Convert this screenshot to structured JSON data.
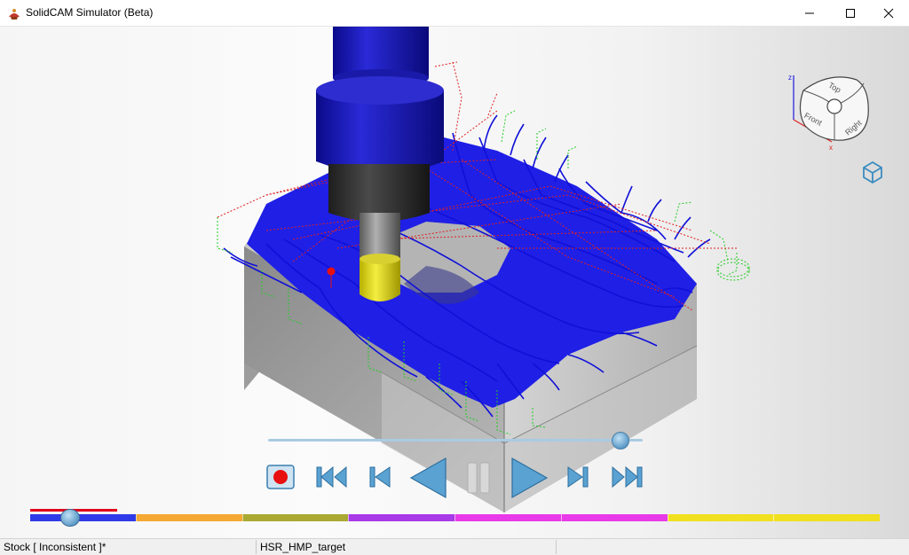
{
  "window": {
    "title": "SolidCAM Simulator (Beta)",
    "controls": {
      "minimize_icon": "minimize-icon",
      "maximize_icon": "maximize-icon",
      "close_icon": "close-icon"
    }
  },
  "viewcube": {
    "faces": {
      "top": "Top",
      "front": "Front",
      "right": "Right"
    },
    "axes": {
      "z": "z",
      "x": "x"
    }
  },
  "playback": {
    "speed_level": 0.94,
    "buttons": [
      {
        "name": "record-button",
        "icon": "record-icon"
      },
      {
        "name": "skip-to-start-button",
        "icon": "skip-to-start-icon"
      },
      {
        "name": "step-back-button",
        "icon": "step-back-icon"
      },
      {
        "name": "play-reverse-button",
        "icon": "play-reverse-icon"
      },
      {
        "name": "pause-button",
        "icon": "pause-icon"
      },
      {
        "name": "play-button",
        "icon": "play-icon"
      },
      {
        "name": "step-forward-button",
        "icon": "step-forward-icon"
      },
      {
        "name": "skip-to-end-button",
        "icon": "skip-to-end-icon"
      }
    ]
  },
  "timeline": {
    "position": 0.047,
    "segment_colors": [
      "#2f3be8",
      "#f5a833",
      "#a9a933",
      "#a83ae8",
      "#e83ae8",
      "#e83ae8",
      "#f0e020",
      "#f0e020"
    ],
    "completed_color": "#e0001b"
  },
  "status": {
    "stock": "Stock [ Inconsistent ]*",
    "target": "HSR_HMP_target"
  },
  "colors": {
    "toolpath_blue": "#1a1aff",
    "rapid_red": "#e02020",
    "link_green": "#22cc22",
    "holder_blue": "#1a1ab8",
    "tool_yellow": "#e8e020",
    "accent_blue": "#4a9fd0"
  }
}
